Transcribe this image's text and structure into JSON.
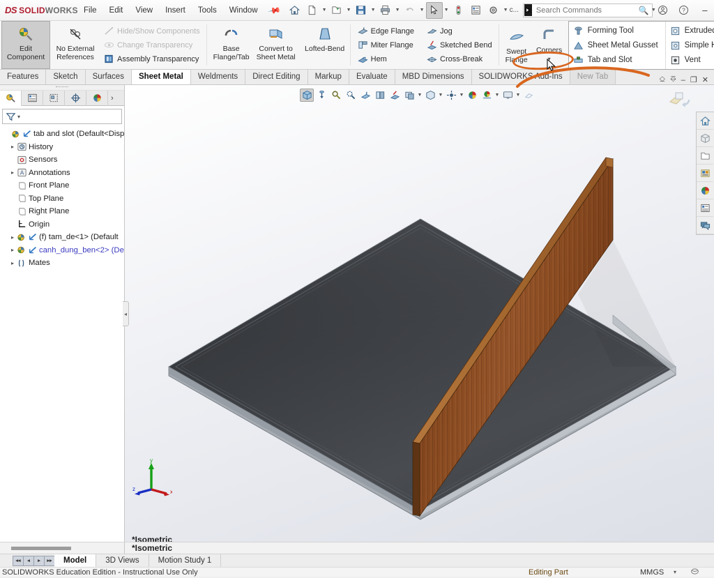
{
  "app": {
    "brand_ds": "DS",
    "brand_sol": "SOLID",
    "brand_works": "WORKS",
    "pin_icon": "pin-icon"
  },
  "menu": {
    "items": [
      {
        "label": "File"
      },
      {
        "label": "Edit"
      },
      {
        "label": "View"
      },
      {
        "label": "Insert"
      },
      {
        "label": "Tools"
      },
      {
        "label": "Window"
      }
    ]
  },
  "quick_access": {
    "buttons": [
      {
        "name": "home-icon",
        "title": "Home"
      },
      {
        "name": "new-document-icon",
        "title": "New"
      },
      {
        "name": "open-folder-icon",
        "title": "Open"
      },
      {
        "name": "save-icon",
        "title": "Save"
      },
      {
        "name": "print-icon",
        "title": "Print"
      },
      {
        "name": "undo-icon",
        "title": "Undo"
      },
      {
        "name": "select-arrow-icon",
        "title": "Select"
      },
      {
        "name": "rebuild-icon",
        "title": "Rebuild"
      },
      {
        "name": "file-properties-icon",
        "title": "File Properties"
      },
      {
        "name": "options-gear-icon",
        "title": "Options"
      }
    ],
    "overflow_label": "c..."
  },
  "search": {
    "placeholder": "Search Commands",
    "value": ""
  },
  "window": {
    "account_icon": "account-icon",
    "help_icon": "help-icon",
    "minimize": "–",
    "maximize": "☐",
    "close": "✕"
  },
  "ribbon": {
    "assembly_group": {
      "edit_component": {
        "line1": "Edit",
        "line2": "Component",
        "icon": "edit-component-icon"
      },
      "no_external_references": {
        "line1": "No External",
        "line2": "References",
        "icon": "no-external-references-icon"
      },
      "hide_show_components": {
        "label": "Hide/Show Components",
        "icon": "hide-show-components-icon"
      },
      "change_transparency": {
        "label": "Change Transparency",
        "icon": "change-transparency-icon"
      },
      "assembly_transparency": {
        "label": "Assembly Transparency",
        "icon": "assembly-transparency-icon"
      }
    },
    "sheetmetal_big": [
      {
        "line1": "Base",
        "line2": "Flange/Tab",
        "icon": "base-flange-tab-icon"
      },
      {
        "line1": "Convert to",
        "line2": "Sheet Metal",
        "icon": "convert-to-sheet-metal-icon"
      },
      {
        "line1": "Lofted-Bend",
        "line2": "",
        "icon": "lofted-bend-icon"
      }
    ],
    "flange_col_a": [
      {
        "label": "Edge Flange",
        "icon": "edge-flange-icon"
      },
      {
        "label": "Miter Flange",
        "icon": "miter-flange-icon"
      },
      {
        "label": "Hem",
        "icon": "hem-icon"
      }
    ],
    "flange_col_b": [
      {
        "label": "Jog",
        "icon": "jog-icon"
      },
      {
        "label": "Sketched Bend",
        "icon": "sketched-bend-icon"
      },
      {
        "label": "Cross-Break",
        "icon": "cross-break-icon"
      }
    ],
    "swept_flange": {
      "line1": "Swept",
      "line2": "Flange",
      "icon": "swept-flange-icon"
    },
    "corners": {
      "line1": "Corners",
      "line2": "",
      "icon": "corners-icon",
      "dropdown": "▾"
    },
    "dropdown_panel": {
      "left": [
        {
          "label": "Forming Tool",
          "icon": "forming-tool-icon"
        },
        {
          "label": "Sheet Metal Gusset",
          "icon": "sheet-metal-gusset-icon"
        },
        {
          "label": "Tab and Slot",
          "icon": "tab-and-slot-icon",
          "highlighted": true
        }
      ],
      "right": [
        {
          "label": "Extruded Cut",
          "icon": "extruded-cut-icon",
          "chev": ""
        },
        {
          "label": "Simple Hole",
          "icon": "simple-hole-icon",
          "chev": "»"
        },
        {
          "label": "Vent",
          "icon": "vent-icon",
          "chev": ""
        }
      ]
    },
    "tail": {
      "play": "▶",
      "expand": "»"
    }
  },
  "tabs": {
    "items": [
      {
        "label": "Features",
        "selected": false
      },
      {
        "label": "Sketch",
        "selected": false
      },
      {
        "label": "Surfaces",
        "selected": false
      },
      {
        "label": "Sheet Metal",
        "selected": true
      },
      {
        "label": "Weldments",
        "selected": false
      },
      {
        "label": "Direct Editing",
        "selected": false
      },
      {
        "label": "Markup",
        "selected": false
      },
      {
        "label": "Evaluate",
        "selected": false
      },
      {
        "label": "MBD Dimensions",
        "selected": false
      },
      {
        "label": "SOLIDWORKS Add-Ins",
        "selected": false
      },
      {
        "label": "New Tab",
        "selected": false,
        "ghost": true
      }
    ],
    "right_controls": [
      {
        "name": "panel-left-icon",
        "glyph": "⎐"
      },
      {
        "name": "panel-right-icon",
        "glyph": "⎑"
      },
      {
        "name": "minimize-doc-icon",
        "glyph": "–"
      },
      {
        "name": "restore-doc-icon",
        "glyph": "❐"
      },
      {
        "name": "close-doc-icon",
        "glyph": "✕"
      }
    ]
  },
  "feature_manager": {
    "tabs": [
      {
        "name": "feature-manager-tree-tab",
        "icon": "feature-tree-icon",
        "selected": true
      },
      {
        "name": "property-manager-tab",
        "icon": "property-manager-icon",
        "selected": false
      },
      {
        "name": "configuration-manager-tab",
        "icon": "configuration-manager-icon",
        "selected": false
      },
      {
        "name": "dimxpert-manager-tab",
        "icon": "dimxpert-icon",
        "selected": false
      },
      {
        "name": "display-manager-tab",
        "icon": "display-manager-icon",
        "selected": false
      }
    ],
    "expand_chevron": "›",
    "filter": {
      "icon": "filter-icon",
      "caret": "▾",
      "value": "",
      "placeholder": ""
    },
    "tree": [
      {
        "label": "tab and slot  (Default<Disp",
        "indent": 0,
        "twist": "",
        "icon": "assembly-icon",
        "icon2": "coordinate-icon",
        "blue": false
      },
      {
        "label": "History",
        "indent": 1,
        "twist": "▸",
        "icon": "history-icon",
        "icon2": "",
        "blue": false
      },
      {
        "label": "Sensors",
        "indent": 1,
        "twist": "",
        "icon": "sensors-icon",
        "icon2": "",
        "blue": false
      },
      {
        "label": "Annotations",
        "indent": 1,
        "twist": "▸",
        "icon": "annotations-icon",
        "icon2": "",
        "blue": false
      },
      {
        "label": "Front Plane",
        "indent": 1,
        "twist": "",
        "icon": "plane-icon",
        "icon2": "",
        "blue": false
      },
      {
        "label": "Top Plane",
        "indent": 1,
        "twist": "",
        "icon": "plane-icon",
        "icon2": "",
        "blue": false
      },
      {
        "label": "Right Plane",
        "indent": 1,
        "twist": "",
        "icon": "plane-icon",
        "icon2": "",
        "blue": false
      },
      {
        "label": "Origin",
        "indent": 1,
        "twist": "",
        "icon": "origin-icon",
        "icon2": "",
        "blue": false
      },
      {
        "label": "(f) tam_de<1>  (Default",
        "indent": 1,
        "twist": "▸",
        "icon": "part-icon",
        "icon2": "coordinate-icon",
        "blue": false
      },
      {
        "label": "canh_dung_ben<2>  (De",
        "indent": 1,
        "twist": "▸",
        "icon": "part-icon",
        "icon2": "coordinate-icon",
        "blue": true
      },
      {
        "label": "Mates",
        "indent": 1,
        "twist": "▸",
        "icon": "mates-icon",
        "icon2": "",
        "blue": false
      }
    ]
  },
  "viewport": {
    "hud_buttons": [
      {
        "name": "zoom-to-fit-icon",
        "active": true,
        "caret": false
      },
      {
        "name": "zoom-to-area-icon",
        "active": false,
        "caret": false
      },
      {
        "name": "previous-view-icon",
        "active": false,
        "caret": false
      },
      {
        "name": "section-view-icon",
        "active": false,
        "caret": false
      },
      {
        "name": "view-orientation-icon",
        "active": false,
        "caret": false
      },
      {
        "name": "display-style-icon",
        "active": false,
        "caret": false
      },
      {
        "name": "hide-show-items-icon",
        "active": false,
        "caret": true
      },
      {
        "name": "edit-appearance-icon",
        "active": false,
        "caret": true
      },
      {
        "name": "apply-scene-icon",
        "active": false,
        "caret": true
      },
      {
        "name": "view-settings-icon",
        "active": false,
        "caret": true
      },
      {
        "name": "rotate-view-icon",
        "active": false,
        "caret": false
      },
      {
        "name": "display-pane-icon",
        "active": false,
        "caret": true
      },
      {
        "name": "perspective-icon",
        "active": false,
        "caret": false
      }
    ],
    "rotate_hint_icon": "rotate-part-icon",
    "view_label": "*Isometric",
    "triad": {
      "x": "x",
      "y": "y",
      "z": "z"
    }
  },
  "task_pane": [
    {
      "name": "solidworks-resources-icon",
      "glyph": "home-icon"
    },
    {
      "name": "design-library-icon",
      "glyph": "library-icon"
    },
    {
      "name": "file-explorer-icon",
      "glyph": "folder-icon"
    },
    {
      "name": "view-palette-icon",
      "glyph": "palette-icon"
    },
    {
      "name": "appearances-scenes-icon",
      "glyph": "sphere-icon"
    },
    {
      "name": "custom-properties-icon",
      "glyph": "properties-icon"
    },
    {
      "name": "solidworks-forum-icon",
      "glyph": "forum-icon"
    }
  ],
  "bottom": {
    "nav_buttons": [
      "◂◂",
      "◂",
      "▸",
      "▸▸"
    ],
    "tabs": [
      {
        "label": "Model",
        "selected": true
      },
      {
        "label": "3D Views",
        "selected": false
      },
      {
        "label": "Motion Study 1",
        "selected": false
      }
    ]
  },
  "status_bar": {
    "edition": "SOLIDWORKS Education Edition - Instructional Use Only",
    "editing": "Editing Part",
    "units": "MMGS",
    "units_caret": "▾",
    "overlay_icon": "overlay-icon"
  },
  "colors": {
    "brand_red": "#b01c2e",
    "highlight_orange": "#d9661f",
    "wood": "#8b4a22",
    "selected_blue": "#3a3ac0",
    "accent_blue": "#dceaf7"
  }
}
